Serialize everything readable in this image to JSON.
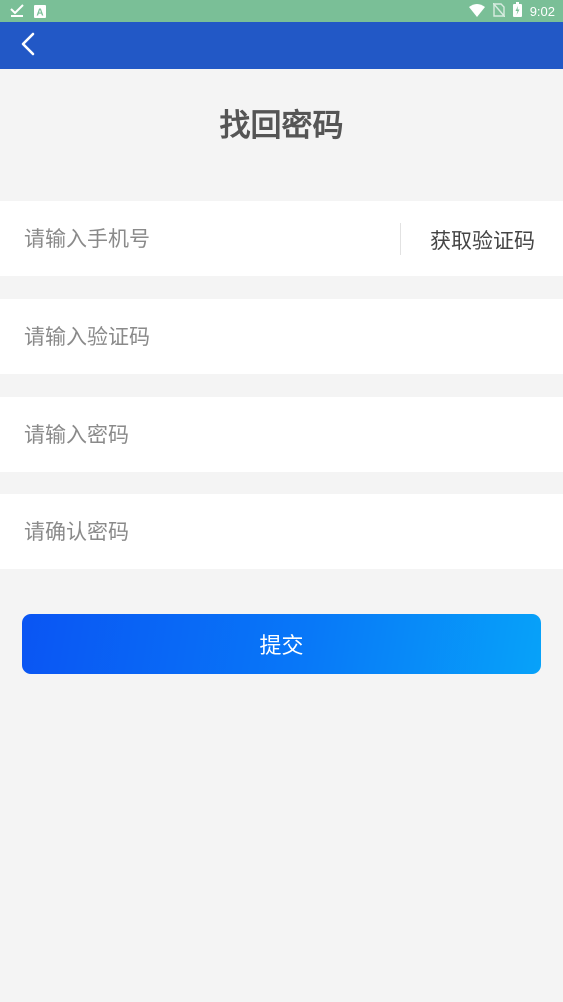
{
  "status_bar": {
    "time": "9:02",
    "left_icons": [
      "check-download-icon",
      "a-notification-icon"
    ],
    "right_icons": [
      "wifi-icon",
      "no-sim-icon",
      "battery-icon"
    ],
    "background": "#7abf97"
  },
  "app_bar": {
    "background": "#2258c6",
    "back_icon": "chevron-left-icon"
  },
  "page": {
    "title": "找回密码"
  },
  "form": {
    "phone_placeholder": "请输入手机号",
    "get_code_label": "获取验证码",
    "code_placeholder": "请输入验证码",
    "password_placeholder": "请输入密码",
    "confirm_placeholder": "请确认密码",
    "submit_label": "提交"
  },
  "colors": {
    "page_background": "#f4f4f4",
    "submit_gradient_start": "#0a55f3",
    "submit_gradient_end": "#07a2f9"
  }
}
